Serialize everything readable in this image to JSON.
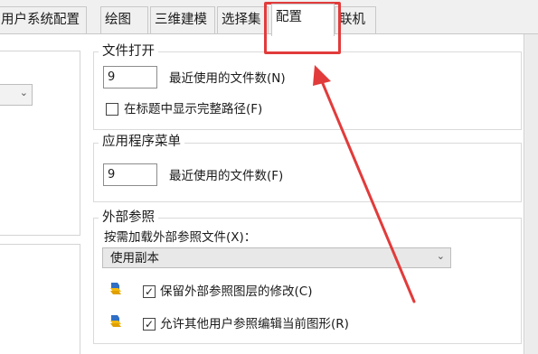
{
  "tabs": [
    {
      "label": "用户系统配置",
      "active": false
    },
    {
      "label": "绘图",
      "active": false
    },
    {
      "label": "三维建模",
      "active": false
    },
    {
      "label": "选择集",
      "active": false
    },
    {
      "label": "配置",
      "active": true
    },
    {
      "label": "联机",
      "active": false
    }
  ],
  "file_open": {
    "title": "文件打开",
    "recent_count_value": "9",
    "recent_count_label": "最近使用的文件数(N)",
    "show_full_path_label": "在标题中显示完整路径(F)",
    "show_full_path_checked": false
  },
  "app_menu": {
    "title": "应用程序菜单",
    "recent_count_value": "9",
    "recent_count_label": "最近使用的文件数(F)"
  },
  "xref": {
    "title": "外部参照",
    "demand_load_label": "按需加载外部参照文件(X)：",
    "demand_load_value": "使用副本",
    "retain_changes_label": "保留外部参照图层的修改(C)",
    "retain_changes_checked": true,
    "allow_edit_label": "允许其他用户参照编辑当前图形(R)",
    "allow_edit_checked": true
  },
  "annotation": {
    "color": "#e23b3b"
  },
  "colors": {
    "pane": "#ffffff",
    "chrome": "#f0f0f0",
    "highlight": "#e23b3b"
  }
}
